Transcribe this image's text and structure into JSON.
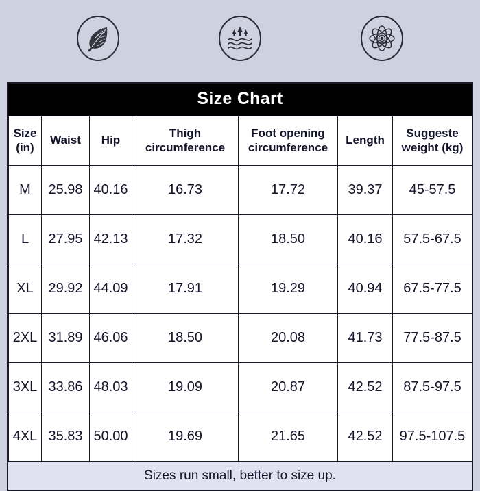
{
  "colors": {
    "page_background": "#ced1e0",
    "title_background": "#000000",
    "title_text": "#ffffff",
    "table_background": "#ffffff",
    "table_text": "#14142a",
    "note_background": "#e1e1f1",
    "border": "#1a1a28"
  },
  "feature_icons": [
    {
      "name": "feather-icon",
      "label": "feather"
    },
    {
      "name": "moisture-wicking-icon",
      "label": "moisture wicking"
    },
    {
      "name": "atom-icon",
      "label": "atom"
    }
  ],
  "chart": {
    "title": "Size Chart",
    "note": "Sizes run small,  better to size up.",
    "columns": [
      "Size\n(in)",
      "Waist",
      "Hip",
      "Thigh\ncircumference",
      "Foot opening\ncircumference",
      "Length",
      "Suggeste\nweight  (kg)"
    ],
    "column_lines": [
      [
        "Size",
        "(in)"
      ],
      [
        "Waist",
        ""
      ],
      [
        "Hip",
        ""
      ],
      [
        "Thigh",
        "circumference"
      ],
      [
        "Foot opening",
        "circumference"
      ],
      [
        "Length",
        ""
      ],
      [
        "Suggeste",
        "weight  (kg)"
      ]
    ],
    "rows": [
      {
        "size": "M",
        "waist": "25.98",
        "hip": "40.16",
        "thigh": "16.73",
        "foot_opening": "17.72",
        "length": "39.37",
        "weight": "45-57.5"
      },
      {
        "size": "L",
        "waist": "27.95",
        "hip": "42.13",
        "thigh": "17.32",
        "foot_opening": "18.50",
        "length": "40.16",
        "weight": "57.5-67.5"
      },
      {
        "size": "XL",
        "waist": "29.92",
        "hip": "44.09",
        "thigh": "17.91",
        "foot_opening": "19.29",
        "length": "40.94",
        "weight": "67.5-77.5"
      },
      {
        "size": "2XL",
        "waist": "31.89",
        "hip": "46.06",
        "thigh": "18.50",
        "foot_opening": "20.08",
        "length": "41.73",
        "weight": "77.5-87.5"
      },
      {
        "size": "3XL",
        "waist": "33.86",
        "hip": "48.03",
        "thigh": "19.09",
        "foot_opening": "20.87",
        "length": "42.52",
        "weight": "87.5-97.5"
      },
      {
        "size": "4XL",
        "waist": "35.83",
        "hip": "50.00",
        "thigh": "19.69",
        "foot_opening": "21.65",
        "length": "42.52",
        "weight": "97.5-107.5"
      }
    ]
  }
}
